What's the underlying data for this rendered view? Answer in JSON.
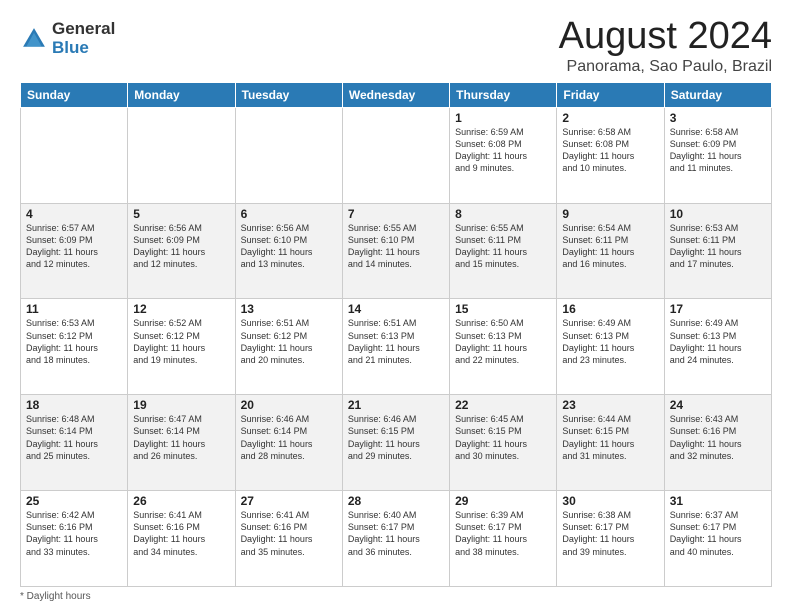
{
  "app": {
    "logo_line1": "General",
    "logo_line2": "Blue"
  },
  "header": {
    "month_year": "August 2024",
    "location": "Panorama, Sao Paulo, Brazil"
  },
  "days_of_week": [
    "Sunday",
    "Monday",
    "Tuesday",
    "Wednesday",
    "Thursday",
    "Friday",
    "Saturday"
  ],
  "footer": {
    "note": "Daylight hours"
  },
  "weeks": [
    [
      {
        "day": "",
        "info": ""
      },
      {
        "day": "",
        "info": ""
      },
      {
        "day": "",
        "info": ""
      },
      {
        "day": "",
        "info": ""
      },
      {
        "day": "1",
        "info": "Sunrise: 6:59 AM\nSunset: 6:08 PM\nDaylight: 11 hours\nand 9 minutes."
      },
      {
        "day": "2",
        "info": "Sunrise: 6:58 AM\nSunset: 6:08 PM\nDaylight: 11 hours\nand 10 minutes."
      },
      {
        "day": "3",
        "info": "Sunrise: 6:58 AM\nSunset: 6:09 PM\nDaylight: 11 hours\nand 11 minutes."
      }
    ],
    [
      {
        "day": "4",
        "info": "Sunrise: 6:57 AM\nSunset: 6:09 PM\nDaylight: 11 hours\nand 12 minutes."
      },
      {
        "day": "5",
        "info": "Sunrise: 6:56 AM\nSunset: 6:09 PM\nDaylight: 11 hours\nand 12 minutes."
      },
      {
        "day": "6",
        "info": "Sunrise: 6:56 AM\nSunset: 6:10 PM\nDaylight: 11 hours\nand 13 minutes."
      },
      {
        "day": "7",
        "info": "Sunrise: 6:55 AM\nSunset: 6:10 PM\nDaylight: 11 hours\nand 14 minutes."
      },
      {
        "day": "8",
        "info": "Sunrise: 6:55 AM\nSunset: 6:11 PM\nDaylight: 11 hours\nand 15 minutes."
      },
      {
        "day": "9",
        "info": "Sunrise: 6:54 AM\nSunset: 6:11 PM\nDaylight: 11 hours\nand 16 minutes."
      },
      {
        "day": "10",
        "info": "Sunrise: 6:53 AM\nSunset: 6:11 PM\nDaylight: 11 hours\nand 17 minutes."
      }
    ],
    [
      {
        "day": "11",
        "info": "Sunrise: 6:53 AM\nSunset: 6:12 PM\nDaylight: 11 hours\nand 18 minutes."
      },
      {
        "day": "12",
        "info": "Sunrise: 6:52 AM\nSunset: 6:12 PM\nDaylight: 11 hours\nand 19 minutes."
      },
      {
        "day": "13",
        "info": "Sunrise: 6:51 AM\nSunset: 6:12 PM\nDaylight: 11 hours\nand 20 minutes."
      },
      {
        "day": "14",
        "info": "Sunrise: 6:51 AM\nSunset: 6:13 PM\nDaylight: 11 hours\nand 21 minutes."
      },
      {
        "day": "15",
        "info": "Sunrise: 6:50 AM\nSunset: 6:13 PM\nDaylight: 11 hours\nand 22 minutes."
      },
      {
        "day": "16",
        "info": "Sunrise: 6:49 AM\nSunset: 6:13 PM\nDaylight: 11 hours\nand 23 minutes."
      },
      {
        "day": "17",
        "info": "Sunrise: 6:49 AM\nSunset: 6:13 PM\nDaylight: 11 hours\nand 24 minutes."
      }
    ],
    [
      {
        "day": "18",
        "info": "Sunrise: 6:48 AM\nSunset: 6:14 PM\nDaylight: 11 hours\nand 25 minutes."
      },
      {
        "day": "19",
        "info": "Sunrise: 6:47 AM\nSunset: 6:14 PM\nDaylight: 11 hours\nand 26 minutes."
      },
      {
        "day": "20",
        "info": "Sunrise: 6:46 AM\nSunset: 6:14 PM\nDaylight: 11 hours\nand 28 minutes."
      },
      {
        "day": "21",
        "info": "Sunrise: 6:46 AM\nSunset: 6:15 PM\nDaylight: 11 hours\nand 29 minutes."
      },
      {
        "day": "22",
        "info": "Sunrise: 6:45 AM\nSunset: 6:15 PM\nDaylight: 11 hours\nand 30 minutes."
      },
      {
        "day": "23",
        "info": "Sunrise: 6:44 AM\nSunset: 6:15 PM\nDaylight: 11 hours\nand 31 minutes."
      },
      {
        "day": "24",
        "info": "Sunrise: 6:43 AM\nSunset: 6:16 PM\nDaylight: 11 hours\nand 32 minutes."
      }
    ],
    [
      {
        "day": "25",
        "info": "Sunrise: 6:42 AM\nSunset: 6:16 PM\nDaylight: 11 hours\nand 33 minutes."
      },
      {
        "day": "26",
        "info": "Sunrise: 6:41 AM\nSunset: 6:16 PM\nDaylight: 11 hours\nand 34 minutes."
      },
      {
        "day": "27",
        "info": "Sunrise: 6:41 AM\nSunset: 6:16 PM\nDaylight: 11 hours\nand 35 minutes."
      },
      {
        "day": "28",
        "info": "Sunrise: 6:40 AM\nSunset: 6:17 PM\nDaylight: 11 hours\nand 36 minutes."
      },
      {
        "day": "29",
        "info": "Sunrise: 6:39 AM\nSunset: 6:17 PM\nDaylight: 11 hours\nand 38 minutes."
      },
      {
        "day": "30",
        "info": "Sunrise: 6:38 AM\nSunset: 6:17 PM\nDaylight: 11 hours\nand 39 minutes."
      },
      {
        "day": "31",
        "info": "Sunrise: 6:37 AM\nSunset: 6:17 PM\nDaylight: 11 hours\nand 40 minutes."
      }
    ]
  ]
}
